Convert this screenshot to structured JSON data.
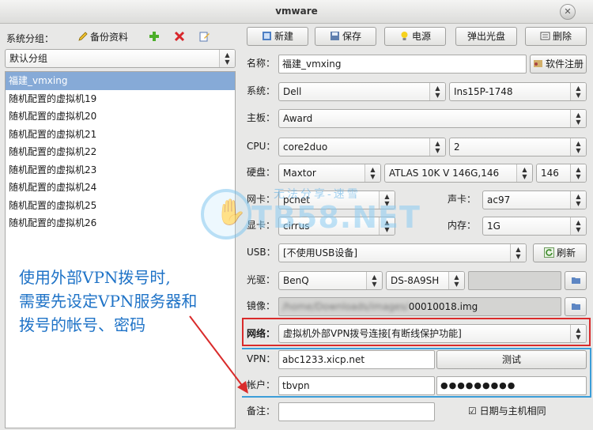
{
  "window": {
    "title": "vmware",
    "close": "✕"
  },
  "sidebar": {
    "group_label": "系统分组：",
    "backup_label": "备份资料",
    "group_selected": "默认分组",
    "items": [
      "福建_vmxing",
      "随机配置的虚拟机19",
      "随机配置的虚拟机20",
      "随机配置的虚拟机21",
      "随机配置的虚拟机22",
      "随机配置的虚拟机23",
      "随机配置的虚拟机24",
      "随机配置的虚拟机25",
      "随机配置的虚拟机26"
    ]
  },
  "toolbar": {
    "new": "新建",
    "save": "保存",
    "power": "电源",
    "eject": "弹出光盘",
    "delete": "删除"
  },
  "form": {
    "name_label": "名称：",
    "name_value": "福建_vmxing",
    "register": "软件注册",
    "system_label": "系统：",
    "system_vendor": "Dell",
    "system_model": "Ins15P-1748",
    "board_label": "主板：",
    "board_value": "Award",
    "cpu_label": "CPU：",
    "cpu_value": "core2duo",
    "cpu_count": "2",
    "disk_label": "硬盘：",
    "disk_vendor": "Maxtor",
    "disk_model": "ATLAS 10K V 146G,146",
    "disk_size": "146",
    "nic_label": "网卡：",
    "nic_value": "pcnet",
    "sound_label": "声卡：",
    "sound_value": "ac97",
    "gpu_label": "显卡：",
    "gpu_value": "cirrus",
    "mem_label": "内存：",
    "mem_value": "1G",
    "usb_label": "USB：",
    "usb_value": "[不使用USB设备]",
    "refresh": "刷新",
    "cdrom_label": "光驱：",
    "cdrom_vendor": "BenQ",
    "cdrom_model": "DS-8A9SH",
    "image_label": "镜像：",
    "image_path_blurred": "/home/Downloads/images/",
    "image_file": "00010018.img",
    "network_label": "网络：",
    "network_value": "虚拟机外部VPN拨号连接[有断线保护功能]",
    "vpn_label": "VPN：",
    "vpn_value": "abc1233.xicp.net",
    "test": "测试",
    "account_label": "帐户：",
    "account_value": "tbvpn",
    "password_value": "●●●●●●●●●",
    "remark_label": "备注：",
    "remark_value": "",
    "date_sync_label": "日期与主机相同",
    "date_sync_checked": "☑"
  },
  "annotation": {
    "lines": [
      "使用外部VPN拨号时,",
      "需要先设定VPN服务器和",
      "拨号的帐号、密码"
    ]
  },
  "watermark": {
    "sub": "无法分享-速雪",
    "text": "TB58.NET"
  },
  "colors": {
    "selection": "#86aad7",
    "highlight_red": "#d92b2b",
    "highlight_blue": "#3b9dd8",
    "annotation_text": "#1f73c7"
  }
}
